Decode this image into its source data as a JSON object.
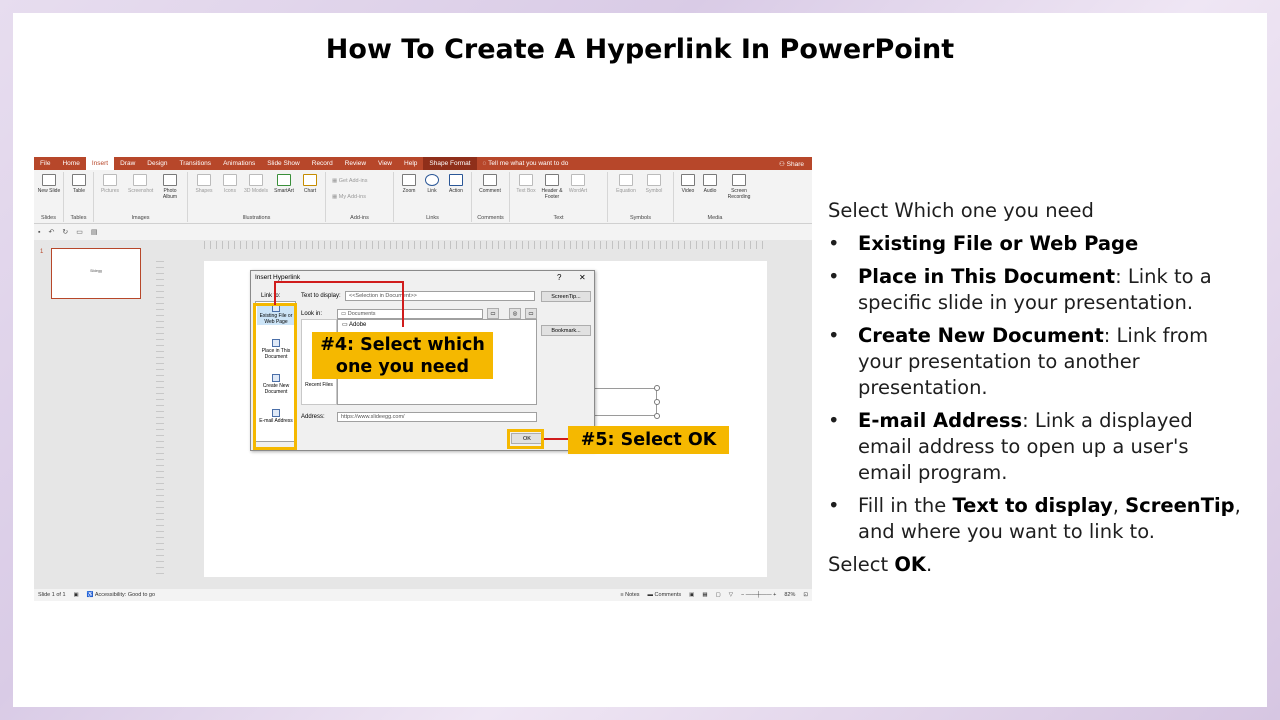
{
  "slide": {
    "title": "How To Create A Hyperlink In PowerPoint"
  },
  "ribbon_tabs": [
    "File",
    "Home",
    "Insert",
    "Draw",
    "Design",
    "Transitions",
    "Animations",
    "Slide Show",
    "Record",
    "Review",
    "View",
    "Help",
    "Shape Format"
  ],
  "active_tab": "Insert",
  "tell_me": "Tell me what you want to do",
  "share": "Share",
  "ribbon_groups": [
    {
      "label": "Slides",
      "buttons": [
        "New Slide"
      ]
    },
    {
      "label": "Tables",
      "buttons": [
        "Table"
      ]
    },
    {
      "label": "Images",
      "buttons": [
        "Pictures",
        "Screenshot",
        "Photo Album"
      ]
    },
    {
      "label": "Illustrations",
      "buttons": [
        "Shapes",
        "Icons",
        "3D Models",
        "SmartArt",
        "Chart"
      ]
    },
    {
      "label": "Add-ins",
      "buttons": [
        "Get Add-ins",
        "My Add-ins"
      ]
    },
    {
      "label": "Links",
      "buttons": [
        "Zoom",
        "Link",
        "Action"
      ]
    },
    {
      "label": "Comments",
      "buttons": [
        "Comment"
      ]
    },
    {
      "label": "Text",
      "buttons": [
        "Text Box",
        "Header & Footer",
        "WordArt"
      ]
    },
    {
      "label": "Symbols",
      "buttons": [
        "Equation",
        "Symbol"
      ]
    },
    {
      "label": "Media",
      "buttons": [
        "Video",
        "Audio",
        "Screen Recording"
      ]
    }
  ],
  "thumbnail": {
    "number": "1",
    "text": "Slidegg"
  },
  "status_bar": {
    "slide_info": "Slide 1 of 1",
    "accessibility": "Accessibility: Good to go",
    "notes": "Notes",
    "comments": "Comments",
    "zoom": "82%"
  },
  "dialog": {
    "title": "Insert Hyperlink",
    "help": "?",
    "close": "✕",
    "link_to_label": "Link to:",
    "text_to_display_label": "Text to display:",
    "text_to_display_value": "<<Selection in Document>>",
    "screentip_button": "ScreenTip...",
    "look_in_label": "Look in:",
    "look_in_value": "Documents",
    "bookmark_button": "Bookmark...",
    "list_first_item": "Adobe",
    "address_label": "Address:",
    "address_value": "https://www.slideegg.com/",
    "ok_button": "OK",
    "recent_files": "Recent Files",
    "link_to_items": [
      "Existing File or Web Page",
      "Place in This Document",
      "Create New Document",
      "E-mail Address"
    ]
  },
  "callouts": {
    "step4": "#4: Select which one you need",
    "step5": "#5: Select OK"
  },
  "right_panel": {
    "intro": "Select Which one you need",
    "bullets": [
      {
        "bold": "Existing File or Web Page",
        "rest": ""
      },
      {
        "bold": "Place in This Document",
        "rest": ":  Link to a specific slide in your presentation."
      },
      {
        "bold": "Create New Document",
        "rest": ": Link from your presentation to another presentation."
      },
      {
        "bold": "E-mail Address",
        "rest": ": Link a displayed email address to open up a user's email program."
      }
    ],
    "fill_prefix": "Fill in the ",
    "fill_b1": "Text to display",
    "fill_sep": ", ",
    "fill_b2": "ScreenTip",
    "fill_suffix": ", and where you want to link to.",
    "select_prefix": "Select ",
    "select_bold": "OK",
    "select_suffix": "."
  },
  "colors": {
    "ribbon_red": "#b7472a",
    "callout_yellow": "#f5b800",
    "arrow_red": "#d01c1c"
  }
}
